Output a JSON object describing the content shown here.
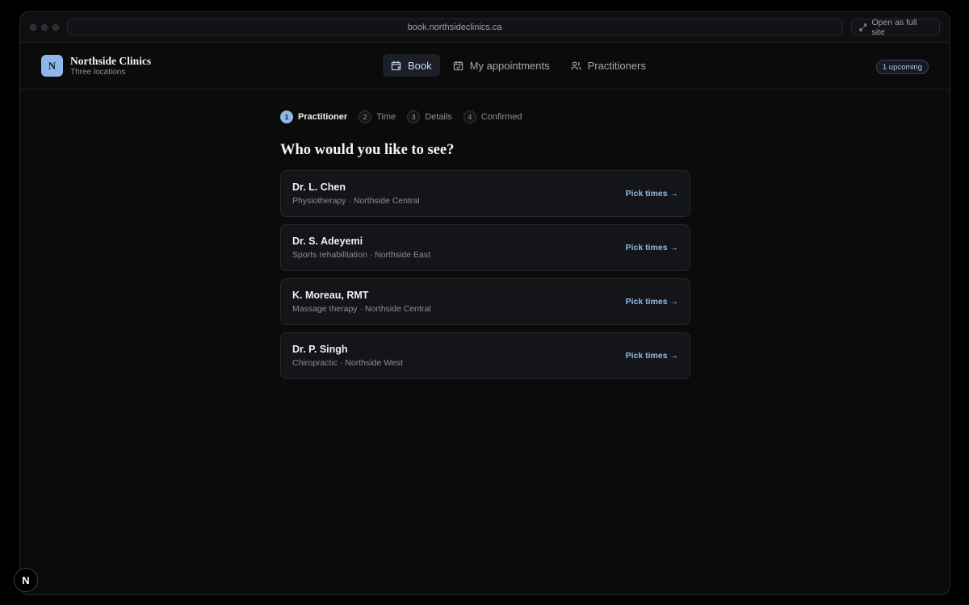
{
  "browser": {
    "url": "book.northsideclinics.ca",
    "full_site_label": "Open as full site"
  },
  "brand": {
    "logo_letter": "N",
    "name": "Northside Clinics",
    "subtitle": "Three locations"
  },
  "nav": {
    "items": [
      {
        "label": "Book",
        "icon": "calendar-plus-icon",
        "active": true
      },
      {
        "label": "My appointments",
        "icon": "calendar-check-icon",
        "active": false
      },
      {
        "label": "Practitioners",
        "icon": "users-icon",
        "active": false
      }
    ]
  },
  "upcoming_badge": "1 upcoming",
  "stepper": {
    "steps": [
      {
        "num": "1",
        "label": "Practitioner",
        "active": true
      },
      {
        "num": "2",
        "label": "Time",
        "active": false
      },
      {
        "num": "3",
        "label": "Details",
        "active": false
      },
      {
        "num": "4",
        "label": "Confirmed",
        "active": false
      }
    ]
  },
  "heading": "Who would you like to see?",
  "practitioners": [
    {
      "name": "Dr. L. Chen",
      "meta": "Physiotherapy · Northside Central",
      "action": "Pick times →"
    },
    {
      "name": "Dr. S. Adeyemi",
      "meta": "Sports rehabilitation · Northside East",
      "action": "Pick times →"
    },
    {
      "name": "K. Moreau, RMT",
      "meta": "Massage therapy · Northside Central",
      "action": "Pick times →"
    },
    {
      "name": "Dr. P. Singh",
      "meta": "Chiropractic · Northside West",
      "action": "Pick times →"
    }
  ],
  "dev_badge": "N",
  "colors": {
    "accent": "#8fb8e8",
    "background": "#0b0b0c",
    "card": "#141518"
  }
}
